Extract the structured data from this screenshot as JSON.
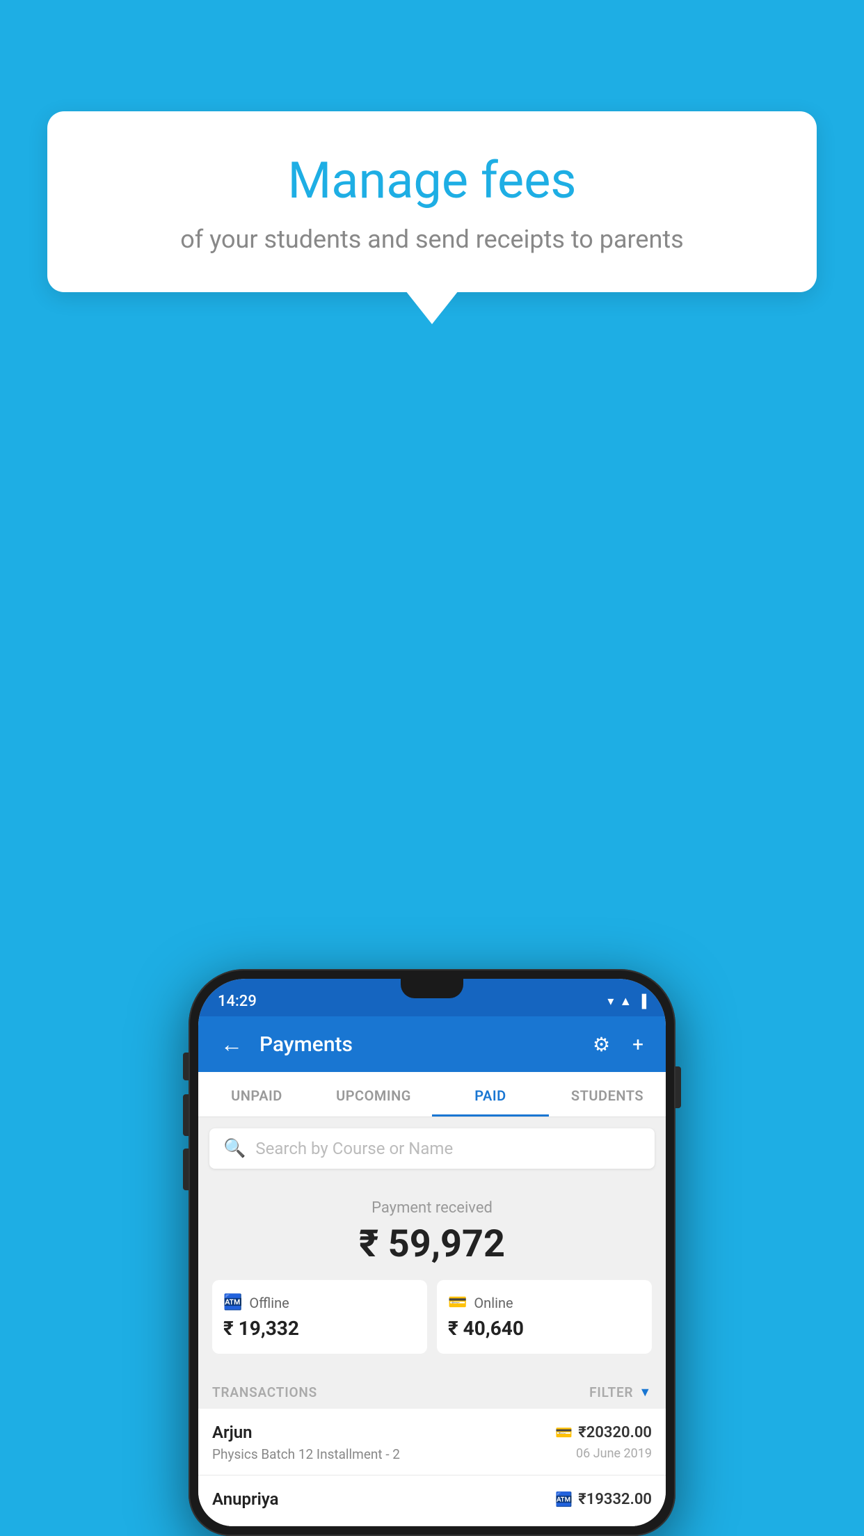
{
  "background_color": "#1EAEE4",
  "tooltip": {
    "title": "Manage fees",
    "subtitle": "of your students and send receipts to parents"
  },
  "status_bar": {
    "time": "14:29",
    "icons": "▼◀▐"
  },
  "header": {
    "title": "Payments",
    "back_label": "←",
    "settings_label": "⚙",
    "add_label": "+"
  },
  "tabs": [
    {
      "label": "UNPAID",
      "active": false
    },
    {
      "label": "UPCOMING",
      "active": false
    },
    {
      "label": "PAID",
      "active": true
    },
    {
      "label": "STUDENTS",
      "active": false
    }
  ],
  "search": {
    "placeholder": "Search by Course or Name"
  },
  "payment_received": {
    "label": "Payment received",
    "total": "₹ 59,972",
    "offline": {
      "icon": "cash",
      "label": "Offline",
      "amount": "₹ 19,332"
    },
    "online": {
      "icon": "card",
      "label": "Online",
      "amount": "₹ 40,640"
    }
  },
  "transactions": {
    "header_label": "TRANSACTIONS",
    "filter_label": "FILTER",
    "items": [
      {
        "name": "Arjun",
        "course": "Physics Batch 12 Installment - 2",
        "amount": "₹20320.00",
        "date": "06 June 2019",
        "payment_type": "online"
      },
      {
        "name": "Anupriya",
        "course": "",
        "amount": "₹19332.00",
        "date": "",
        "payment_type": "offline"
      }
    ]
  }
}
